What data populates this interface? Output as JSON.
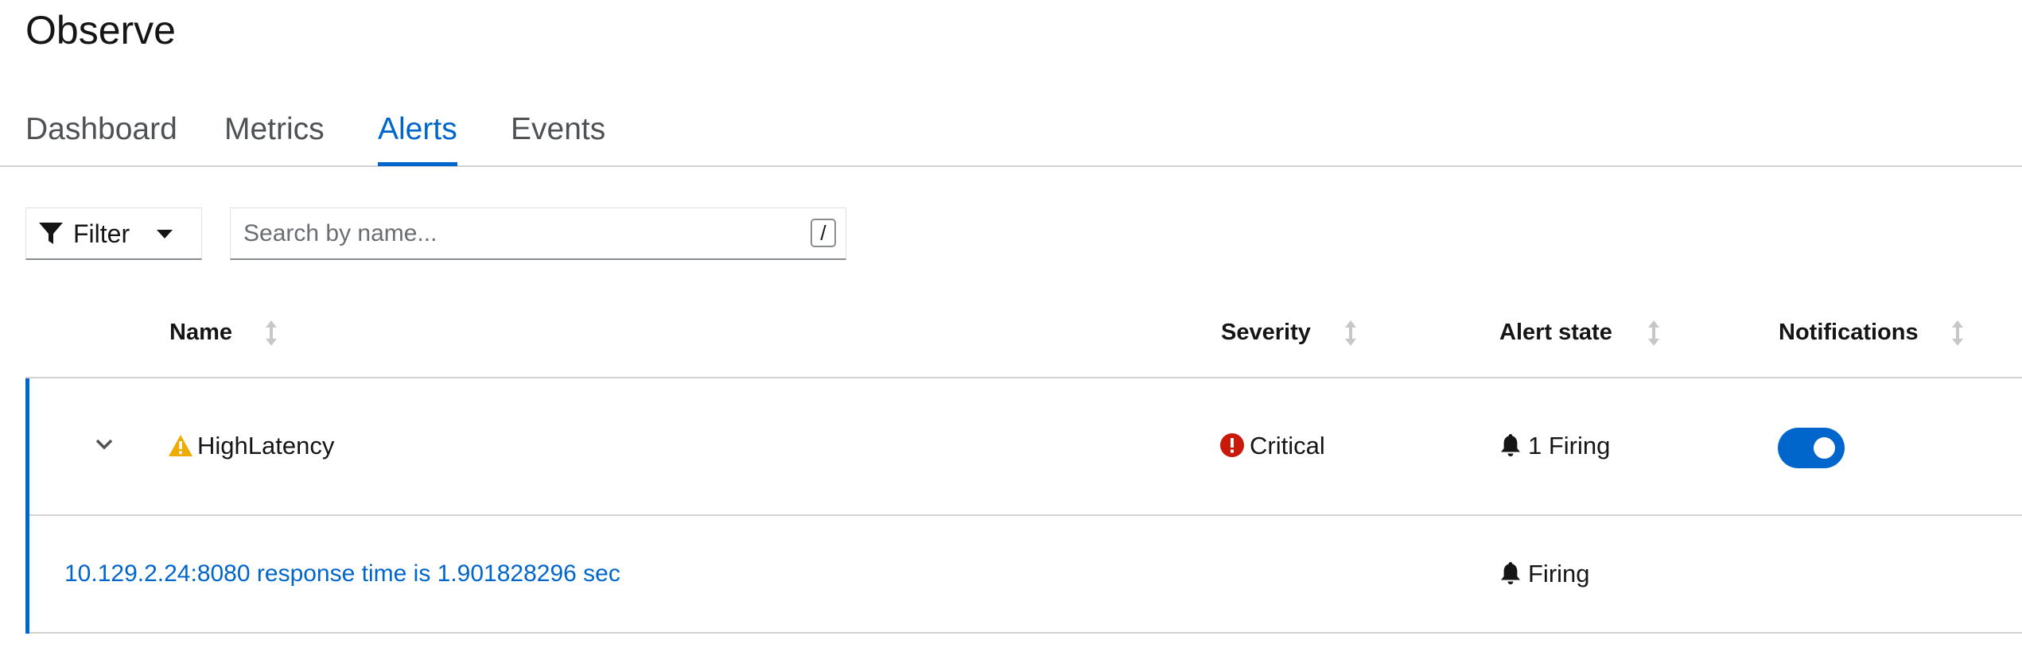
{
  "page": {
    "title": "Observe"
  },
  "tabs": [
    {
      "label": "Dashboard",
      "active": false
    },
    {
      "label": "Metrics",
      "active": false
    },
    {
      "label": "Alerts",
      "active": true
    },
    {
      "label": "Events",
      "active": false
    }
  ],
  "toolbar": {
    "filter_label": "Filter",
    "filter_icon": "filter-icon",
    "search_placeholder": "Search by name...",
    "search_value": "",
    "shortcut_key": "/"
  },
  "table": {
    "columns": [
      {
        "label": "Name",
        "sortable": true
      },
      {
        "label": "Severity",
        "sortable": true
      },
      {
        "label": "Alert state",
        "sortable": true
      },
      {
        "label": "Notifications",
        "sortable": true
      }
    ],
    "rows": [
      {
        "expanded": true,
        "name": "HighLatency",
        "name_icon": "warning-triangle-icon",
        "severity": "Critical",
        "severity_icon": "exclamation-circle-icon",
        "alert_state": "1 Firing",
        "alert_state_icon": "bell-icon",
        "notifications_enabled": true,
        "details": [
          {
            "description": "10.129.2.24:8080 response time is 1.901828296 sec",
            "state": "Firing",
            "state_icon": "bell-icon"
          }
        ]
      }
    ]
  },
  "colors": {
    "accent": "#0066cc",
    "warning": "#f0ab00",
    "danger": "#c9190b",
    "text": "#151515",
    "muted_text": "#4f5255"
  }
}
